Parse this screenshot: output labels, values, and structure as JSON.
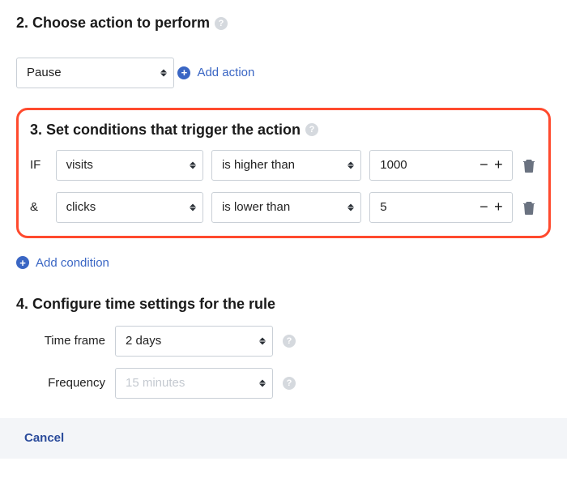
{
  "section2": {
    "heading": "2. Choose action to perform",
    "action_select": "Pause",
    "add_action_label": "Add action"
  },
  "section3": {
    "heading": "3. Set conditions that trigger the action",
    "if_label": "IF",
    "and_label": "&",
    "conditions": [
      {
        "metric": "visits",
        "operator": "is higher than",
        "value": "1000"
      },
      {
        "metric": "clicks",
        "operator": "is lower than",
        "value": "5"
      }
    ],
    "add_condition_label": "Add condition"
  },
  "section4": {
    "heading": "4. Configure time settings for the rule",
    "time_frame_label": "Time frame",
    "time_frame_value": "2 days",
    "frequency_label": "Frequency",
    "frequency_placeholder": "15 minutes"
  },
  "footer": {
    "cancel_label": "Cancel"
  }
}
